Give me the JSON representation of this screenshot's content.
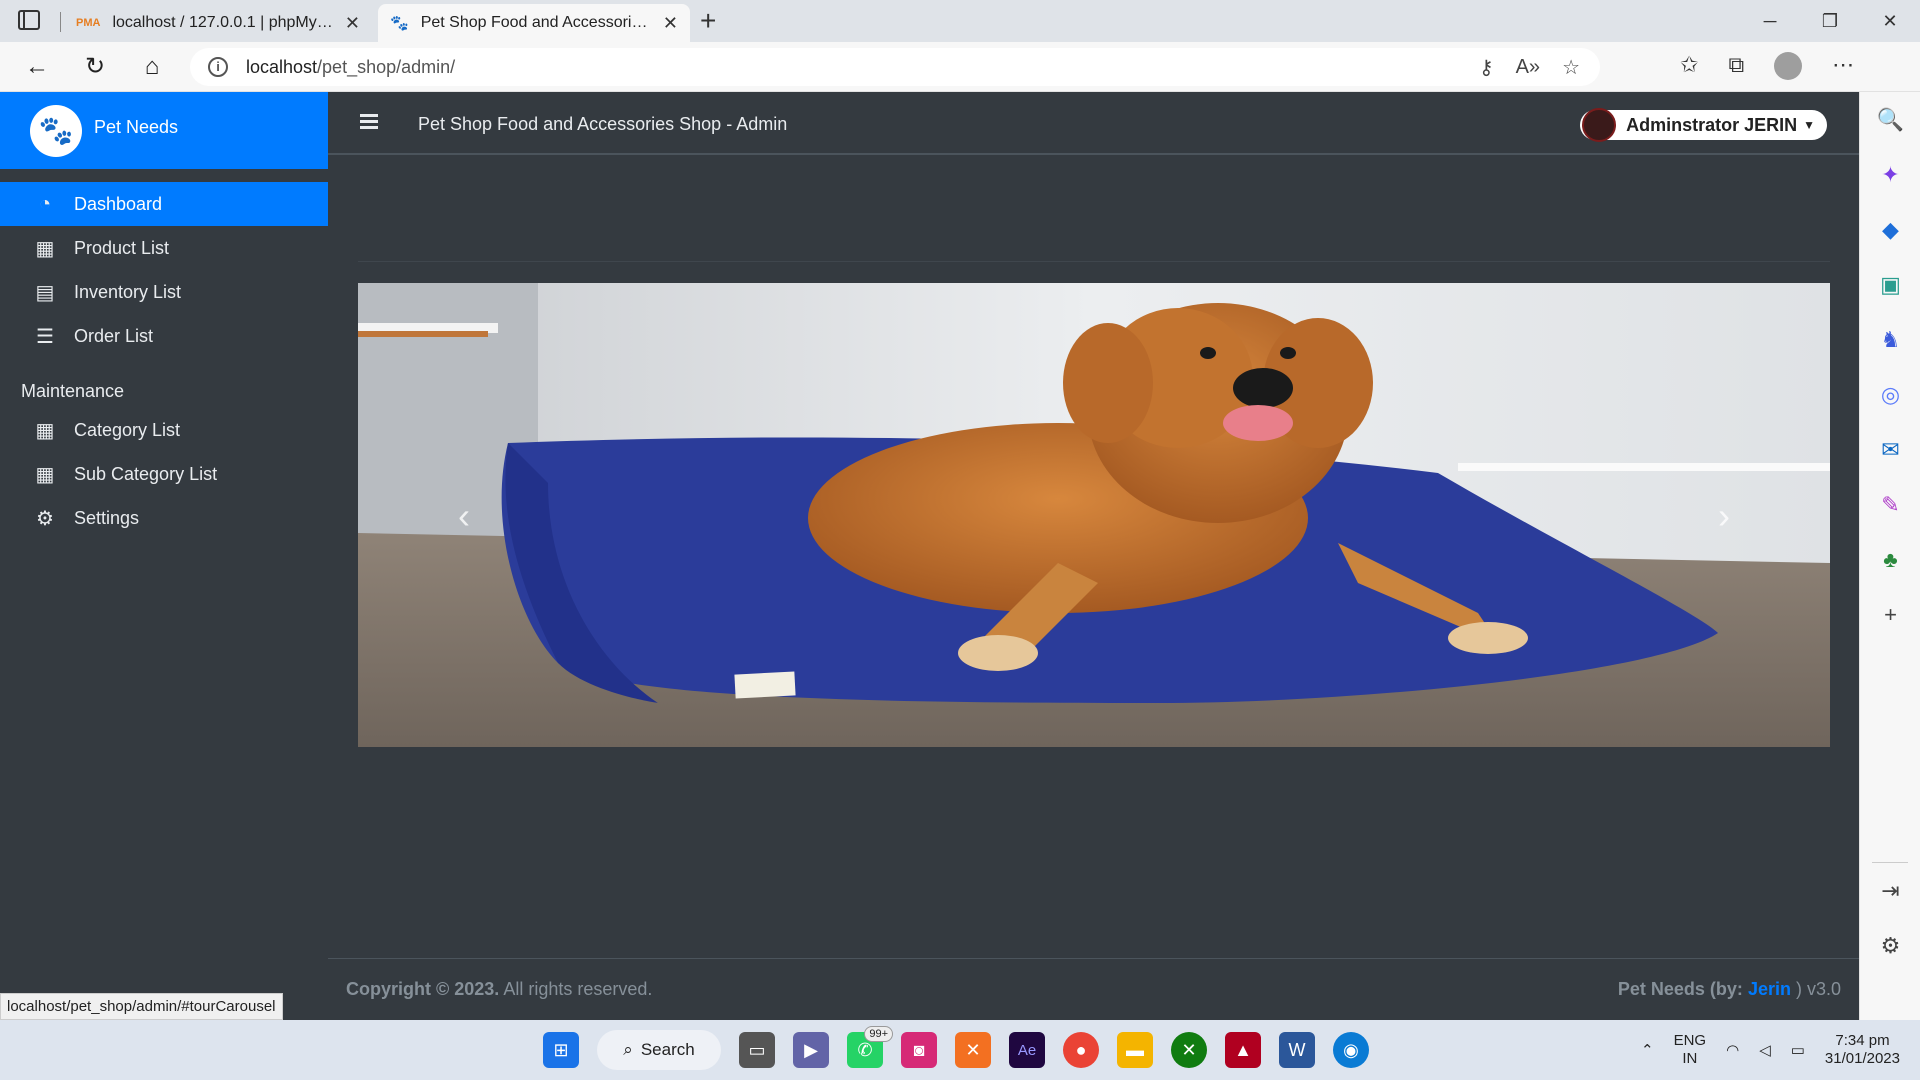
{
  "browser": {
    "tabs": [
      {
        "title": "localhost / 127.0.0.1 | phpMyAdmin",
        "icon": "phpmyadmin-icon",
        "active": false
      },
      {
        "title": "Pet Shop Food and Accessories Shop - Admin",
        "icon": "paw-icon",
        "active": true
      }
    ],
    "url_host": "localhost",
    "url_path": "/pet_shop/admin/",
    "status_url": "localhost/pet_shop/admin/#tourCarousel"
  },
  "sidebar": {
    "brand": "Pet Needs",
    "items": [
      {
        "label": "Dashboard",
        "icon": "dashboard-icon",
        "active": true
      },
      {
        "label": "Product List",
        "icon": "box-icon"
      },
      {
        "label": "Inventory List",
        "icon": "clipboard-icon"
      },
      {
        "label": "Order List",
        "icon": "list-icon"
      }
    ],
    "section_header": "Maintenance",
    "maintenance_items": [
      {
        "label": "Category List",
        "icon": "table-icon"
      },
      {
        "label": "Sub Category List",
        "icon": "table-icon"
      },
      {
        "label": "Settings",
        "icon": "cogs-icon"
      }
    ]
  },
  "header": {
    "title": "Pet Shop Food and Accessories Shop - Admin",
    "user": "Adminstrator JERIN"
  },
  "footer": {
    "copyright_bold": "Copyright © 2023.",
    "copyright_rest": " All rights reserved.",
    "credit_prefix": "Pet Needs (by: ",
    "credit_name": "Jerin",
    "credit_suffix": " ) v3.0"
  },
  "taskbar": {
    "search_label": "Search",
    "whatsapp_badge": "99+",
    "lang_top": "ENG",
    "lang_bottom": "IN",
    "time": "7:34 pm",
    "date": "31/01/2023"
  },
  "colors": {
    "accent": "#007bff",
    "sidebar_bg": "#343a40"
  }
}
